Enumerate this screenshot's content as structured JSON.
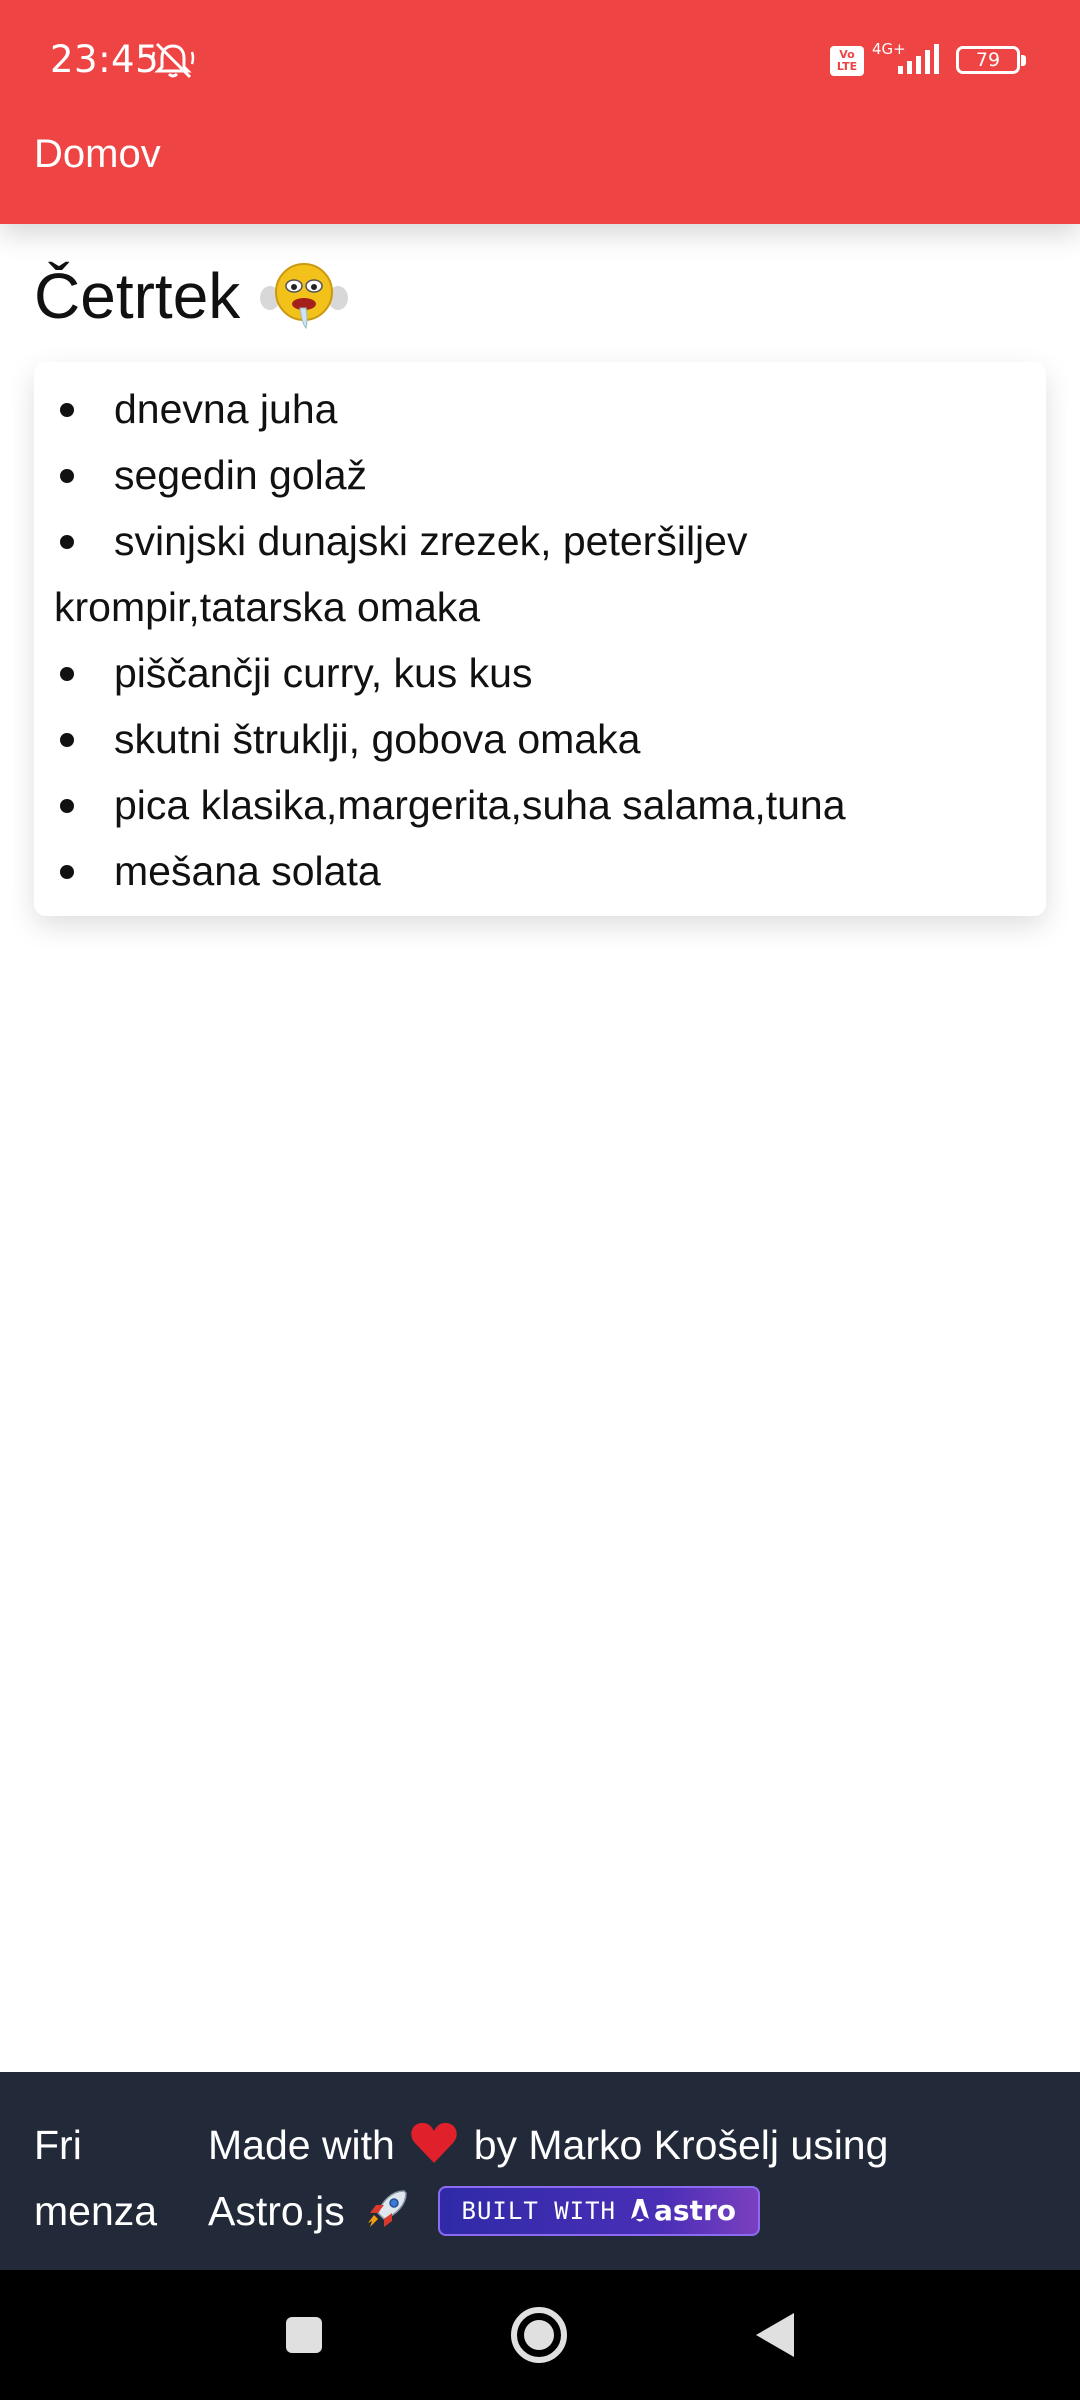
{
  "status_bar": {
    "time": "23:45",
    "network": "4G+",
    "volte": "Vo LTE",
    "battery": "79"
  },
  "header": {
    "home_link": "Domov"
  },
  "day": {
    "title": "Četrtek",
    "items": [
      "dnevna juha",
      "segedin golaž",
      "svinjski dunajski zrezek, peteršiljev krompir,tatarska omaka",
      "piščančji curry, kus kus",
      "skutni štruklji, gobova omaka",
      "pica klasika,margerita,suha salama,tuna",
      "mešana solata"
    ]
  },
  "footer": {
    "brand": "Fri menza",
    "credit_before": "Made with",
    "credit_middle": "by Marko Krošelj using Astro.js",
    "badge_prefix": "BUILT WITH",
    "badge_brand": "astro"
  },
  "colors": {
    "header_bg": "#ef4444",
    "footer_bg": "#222a3a",
    "badge_bg": "#3b2fb0"
  }
}
